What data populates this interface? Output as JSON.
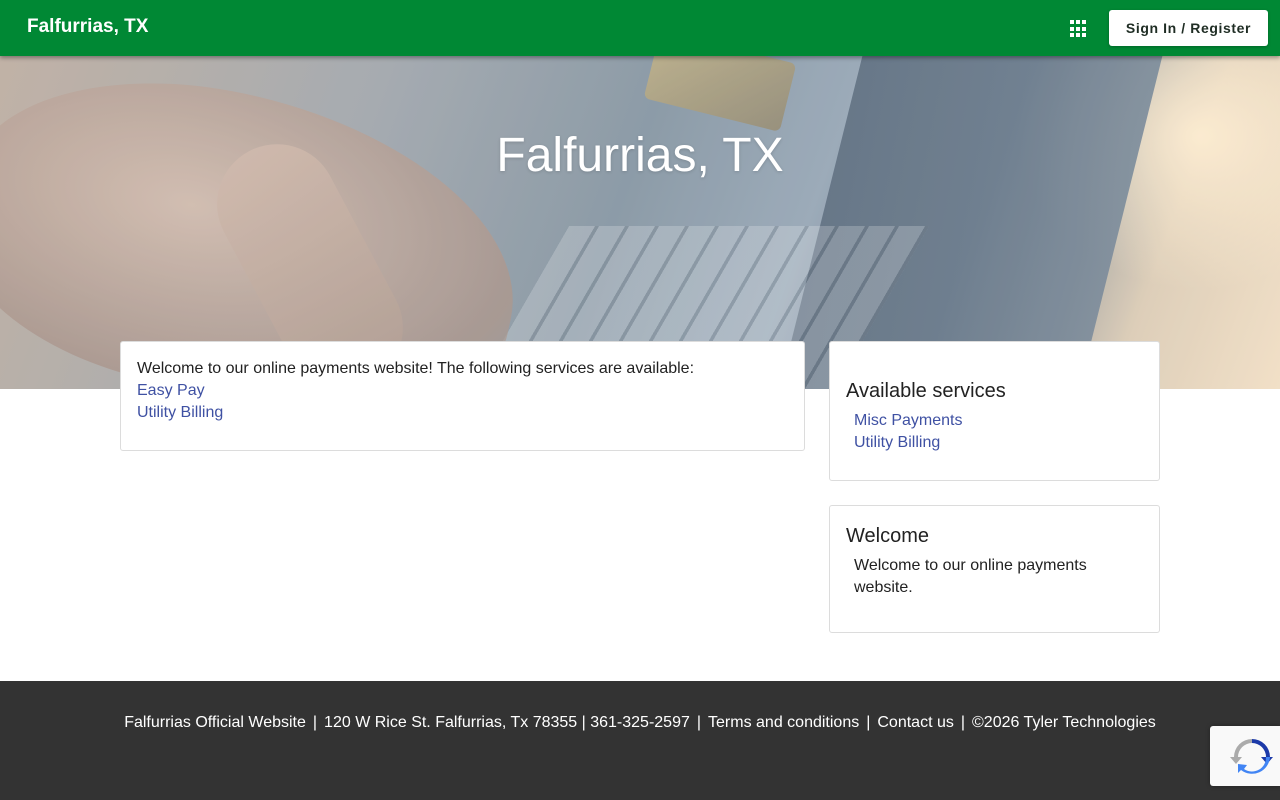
{
  "header": {
    "brand": "Falfurrias, TX",
    "apps_icon": "grid-apps-icon",
    "signin_label": "Sign In / Register"
  },
  "hero": {
    "title": "Falfurrias, TX"
  },
  "main": {
    "intro": "Welcome to our online payments website! The following services are available:",
    "links": [
      "Easy Pay",
      "Utility Billing"
    ]
  },
  "sidebar": {
    "services": {
      "title": "Available services",
      "items": [
        "Misc Payments",
        "Utility Billing"
      ]
    },
    "welcome": {
      "title": "Welcome",
      "text": "Welcome to our online payments website."
    }
  },
  "footer": {
    "site": "Falfurrias Official Website",
    "address": "120 W Rice St. Falfurrias, Tx 78355 | 361-325-2597",
    "terms": "Terms and conditions",
    "contact": "Contact us",
    "copyright": "©2026 Tyler Technologies",
    "separator": "|"
  },
  "colors": {
    "header_bg": "#008834",
    "link": "#3f51a3",
    "footer_bg": "#333333"
  },
  "badge": {
    "icon": "recaptcha-icon"
  }
}
